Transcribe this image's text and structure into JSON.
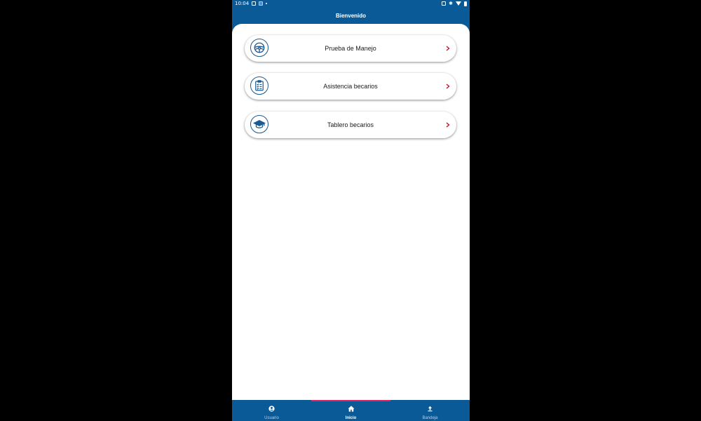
{
  "status_bar": {
    "time": "10:04"
  },
  "header": {
    "title": "Bienvenido"
  },
  "menu": {
    "items": [
      {
        "label": "Prueba de Manejo",
        "icon": "steering-wheel-icon"
      },
      {
        "label": "Asistencia becarios",
        "icon": "clipboard-checklist-icon"
      },
      {
        "label": "Tablero becarios",
        "icon": "graduation-cap-icon"
      }
    ],
    "chevron_color": "#c8102e",
    "icon_color": "#1d5a8f"
  },
  "bottom_nav": {
    "items": [
      {
        "label": "Usuario",
        "icon": "user-icon",
        "active": false
      },
      {
        "label": "Inicio",
        "icon": "home-icon",
        "active": true
      },
      {
        "label": "Bandeja",
        "icon": "upload-icon",
        "active": false
      }
    ],
    "background": "#0a5a98",
    "indicator_color": "#e0245e"
  },
  "colors": {
    "primary": "#0a5a98",
    "surface": "#ffffff"
  }
}
